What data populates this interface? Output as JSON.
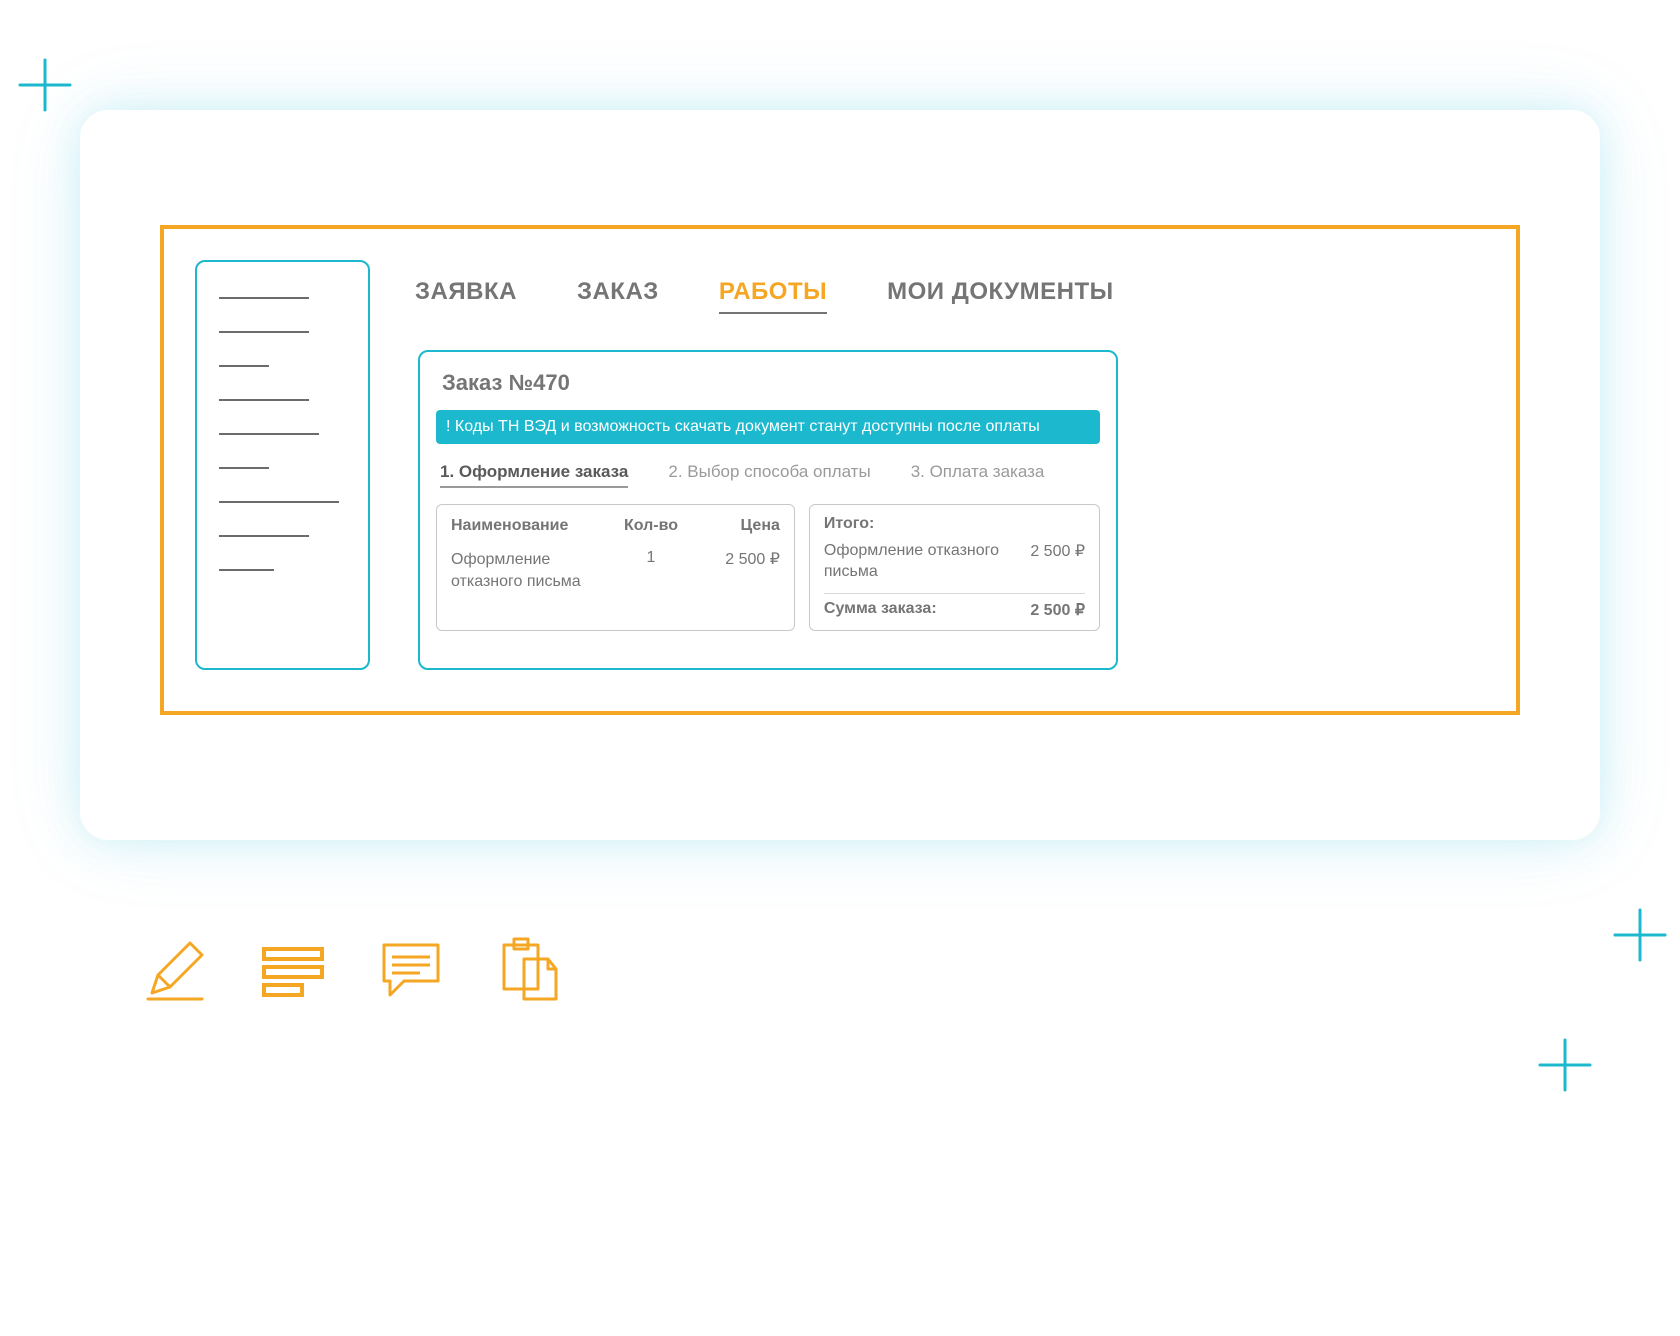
{
  "tabs": {
    "request": "ЗАЯВКА",
    "order": "ЗАКАЗ",
    "works": "РАБОТЫ",
    "documents": "МОИ ДОКУМЕНТЫ"
  },
  "order": {
    "title": "Заказ №470",
    "alert": "! Коды ТН ВЭД и возможность скачать документ станут доступны после оплаты",
    "steps": {
      "s1": "1. Оформление заказа",
      "s2": "2. Выбор способа оплаты",
      "s3": "3. Оплата заказа"
    },
    "items_header": {
      "name": "Наименование",
      "qty": "Кол-во",
      "price": "Цена"
    },
    "items": [
      {
        "name": "Оформление отказного письма",
        "qty": "1",
        "price": "2 500 ₽"
      }
    ],
    "summary": {
      "title": "Итого:",
      "line_label": "Оформление отказного письма",
      "line_value": "2 500 ₽",
      "total_label": "Сумма заказа:",
      "total_value": "2 500 ₽"
    }
  },
  "colors": {
    "accent_orange": "#f5a623",
    "accent_teal": "#1bb8ce",
    "text_gray": "#757575"
  }
}
